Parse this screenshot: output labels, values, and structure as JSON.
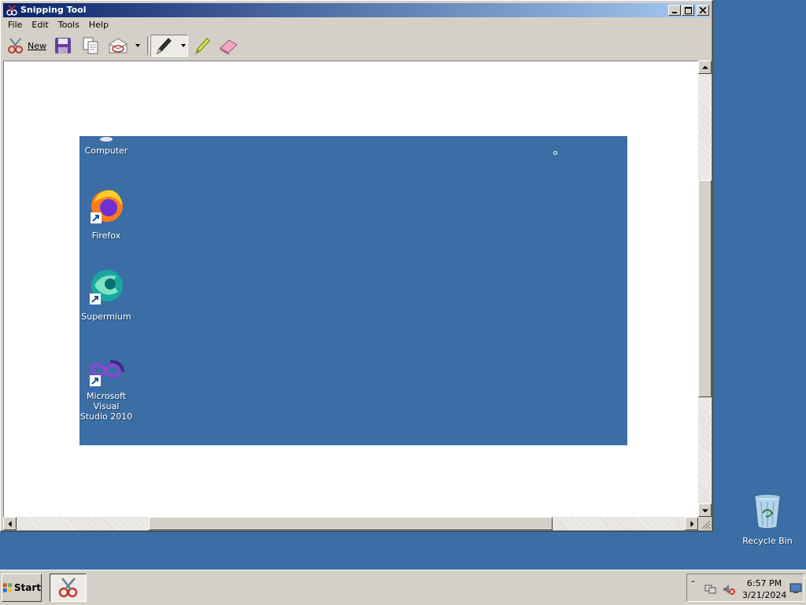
{
  "window": {
    "title": "Snipping Tool",
    "controls": [
      "minimize",
      "maximize",
      "close"
    ]
  },
  "menubar": {
    "items": [
      {
        "label": "File"
      },
      {
        "label": "Edit"
      },
      {
        "label": "Tools"
      },
      {
        "label": "Help"
      }
    ]
  },
  "toolbar": {
    "new_label": "New",
    "icons": [
      "scissors-icon",
      "save-icon",
      "copy-icon",
      "send-email-icon",
      "pen-icon",
      "highlighter-icon",
      "eraser-icon"
    ]
  },
  "snip": {
    "background": "#3a6ea5",
    "icons": [
      {
        "label": "Computer",
        "icon": "computer-icon"
      },
      {
        "label": "Firefox",
        "icon": "firefox-icon"
      },
      {
        "label": "Supermium",
        "icon": "supermium-icon"
      },
      {
        "label_line1": "Microsoft Visual",
        "label_line2": "Studio 2010",
        "icon": "visual-studio-icon"
      }
    ]
  },
  "desktop": {
    "background": "#3a6ea5",
    "recycle_bin_label": "Recycle Bin"
  },
  "taskbar": {
    "start_label": "Start",
    "active_task": "Snipping Tool",
    "clock_time": "6:57 PM",
    "clock_date": "3/21/2024"
  }
}
